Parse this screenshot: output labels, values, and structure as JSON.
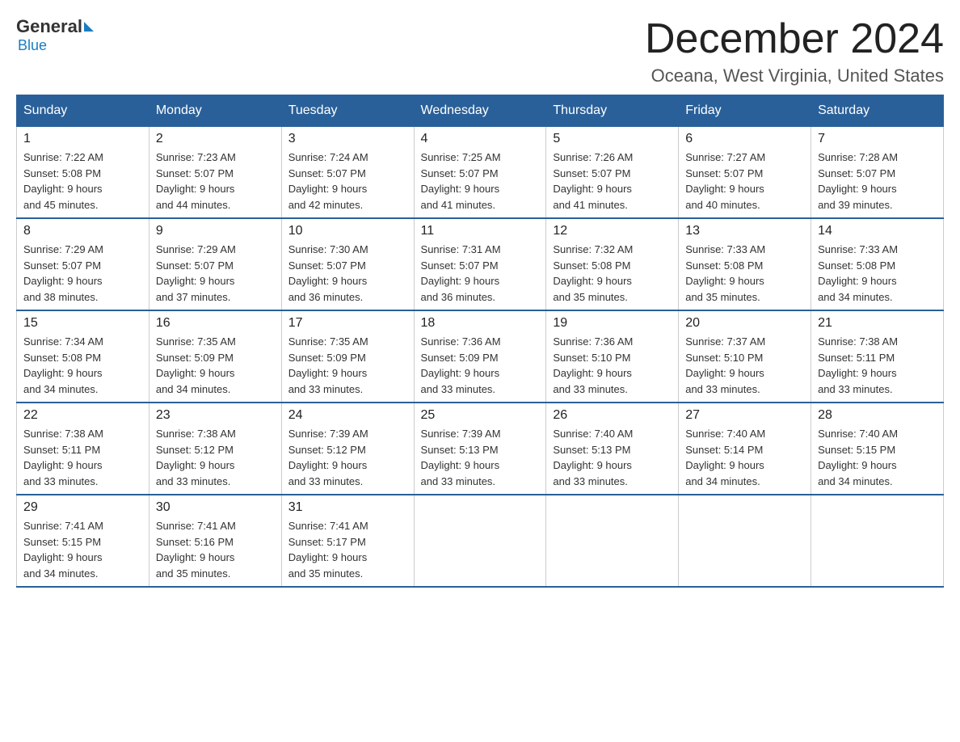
{
  "logo": {
    "general": "General",
    "blue": "Blue"
  },
  "header": {
    "month": "December 2024",
    "location": "Oceana, West Virginia, United States"
  },
  "weekdays": [
    "Sunday",
    "Monday",
    "Tuesday",
    "Wednesday",
    "Thursday",
    "Friday",
    "Saturday"
  ],
  "weeks": [
    [
      {
        "day": "1",
        "sunrise": "7:22 AM",
        "sunset": "5:08 PM",
        "daylight": "9 hours and 45 minutes."
      },
      {
        "day": "2",
        "sunrise": "7:23 AM",
        "sunset": "5:07 PM",
        "daylight": "9 hours and 44 minutes."
      },
      {
        "day": "3",
        "sunrise": "7:24 AM",
        "sunset": "5:07 PM",
        "daylight": "9 hours and 42 minutes."
      },
      {
        "day": "4",
        "sunrise": "7:25 AM",
        "sunset": "5:07 PM",
        "daylight": "9 hours and 41 minutes."
      },
      {
        "day": "5",
        "sunrise": "7:26 AM",
        "sunset": "5:07 PM",
        "daylight": "9 hours and 41 minutes."
      },
      {
        "day": "6",
        "sunrise": "7:27 AM",
        "sunset": "5:07 PM",
        "daylight": "9 hours and 40 minutes."
      },
      {
        "day": "7",
        "sunrise": "7:28 AM",
        "sunset": "5:07 PM",
        "daylight": "9 hours and 39 minutes."
      }
    ],
    [
      {
        "day": "8",
        "sunrise": "7:29 AM",
        "sunset": "5:07 PM",
        "daylight": "9 hours and 38 minutes."
      },
      {
        "day": "9",
        "sunrise": "7:29 AM",
        "sunset": "5:07 PM",
        "daylight": "9 hours and 37 minutes."
      },
      {
        "day": "10",
        "sunrise": "7:30 AM",
        "sunset": "5:07 PM",
        "daylight": "9 hours and 36 minutes."
      },
      {
        "day": "11",
        "sunrise": "7:31 AM",
        "sunset": "5:07 PM",
        "daylight": "9 hours and 36 minutes."
      },
      {
        "day": "12",
        "sunrise": "7:32 AM",
        "sunset": "5:08 PM",
        "daylight": "9 hours and 35 minutes."
      },
      {
        "day": "13",
        "sunrise": "7:33 AM",
        "sunset": "5:08 PM",
        "daylight": "9 hours and 35 minutes."
      },
      {
        "day": "14",
        "sunrise": "7:33 AM",
        "sunset": "5:08 PM",
        "daylight": "9 hours and 34 minutes."
      }
    ],
    [
      {
        "day": "15",
        "sunrise": "7:34 AM",
        "sunset": "5:08 PM",
        "daylight": "9 hours and 34 minutes."
      },
      {
        "day": "16",
        "sunrise": "7:35 AM",
        "sunset": "5:09 PM",
        "daylight": "9 hours and 34 minutes."
      },
      {
        "day": "17",
        "sunrise": "7:35 AM",
        "sunset": "5:09 PM",
        "daylight": "9 hours and 33 minutes."
      },
      {
        "day": "18",
        "sunrise": "7:36 AM",
        "sunset": "5:09 PM",
        "daylight": "9 hours and 33 minutes."
      },
      {
        "day": "19",
        "sunrise": "7:36 AM",
        "sunset": "5:10 PM",
        "daylight": "9 hours and 33 minutes."
      },
      {
        "day": "20",
        "sunrise": "7:37 AM",
        "sunset": "5:10 PM",
        "daylight": "9 hours and 33 minutes."
      },
      {
        "day": "21",
        "sunrise": "7:38 AM",
        "sunset": "5:11 PM",
        "daylight": "9 hours and 33 minutes."
      }
    ],
    [
      {
        "day": "22",
        "sunrise": "7:38 AM",
        "sunset": "5:11 PM",
        "daylight": "9 hours and 33 minutes."
      },
      {
        "day": "23",
        "sunrise": "7:38 AM",
        "sunset": "5:12 PM",
        "daylight": "9 hours and 33 minutes."
      },
      {
        "day": "24",
        "sunrise": "7:39 AM",
        "sunset": "5:12 PM",
        "daylight": "9 hours and 33 minutes."
      },
      {
        "day": "25",
        "sunrise": "7:39 AM",
        "sunset": "5:13 PM",
        "daylight": "9 hours and 33 minutes."
      },
      {
        "day": "26",
        "sunrise": "7:40 AM",
        "sunset": "5:13 PM",
        "daylight": "9 hours and 33 minutes."
      },
      {
        "day": "27",
        "sunrise": "7:40 AM",
        "sunset": "5:14 PM",
        "daylight": "9 hours and 34 minutes."
      },
      {
        "day": "28",
        "sunrise": "7:40 AM",
        "sunset": "5:15 PM",
        "daylight": "9 hours and 34 minutes."
      }
    ],
    [
      {
        "day": "29",
        "sunrise": "7:41 AM",
        "sunset": "5:15 PM",
        "daylight": "9 hours and 34 minutes."
      },
      {
        "day": "30",
        "sunrise": "7:41 AM",
        "sunset": "5:16 PM",
        "daylight": "9 hours and 35 minutes."
      },
      {
        "day": "31",
        "sunrise": "7:41 AM",
        "sunset": "5:17 PM",
        "daylight": "9 hours and 35 minutes."
      },
      null,
      null,
      null,
      null
    ]
  ],
  "labels": {
    "sunrise": "Sunrise:",
    "sunset": "Sunset:",
    "daylight": "Daylight:"
  }
}
